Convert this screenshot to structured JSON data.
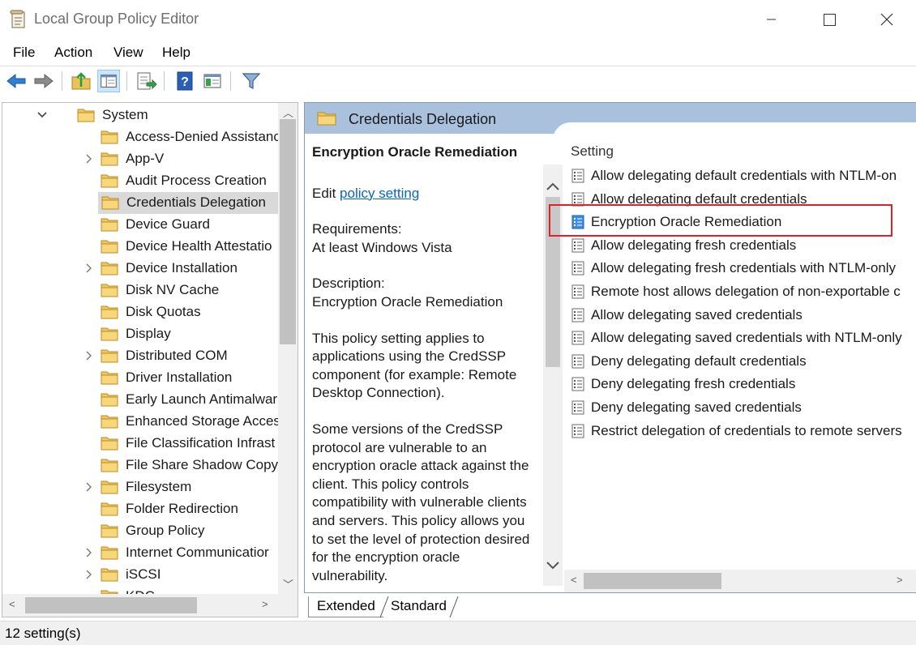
{
  "window": {
    "title": "Local Group Policy Editor"
  },
  "menu": [
    "File",
    "Action",
    "View",
    "Help"
  ],
  "toolbar": {
    "icons": [
      "back-arrow-icon",
      "forward-arrow-icon",
      "up-folder-icon",
      "show-hide-tree-icon",
      "export-list-icon",
      "help-icon",
      "extended-view-icon",
      "filter-icon"
    ]
  },
  "tree": {
    "items": [
      {
        "label": "System",
        "expander": "expanded",
        "selected": false,
        "indent": 0
      },
      {
        "label": "Access-Denied Assistanc",
        "expander": "none",
        "selected": false,
        "indent": 1
      },
      {
        "label": "App-V",
        "expander": "collapsed",
        "selected": false,
        "indent": 1
      },
      {
        "label": "Audit Process Creation",
        "expander": "none",
        "selected": false,
        "indent": 1
      },
      {
        "label": "Credentials Delegation",
        "expander": "none",
        "selected": true,
        "indent": 1
      },
      {
        "label": "Device Guard",
        "expander": "none",
        "selected": false,
        "indent": 1
      },
      {
        "label": "Device Health Attestatio",
        "expander": "none",
        "selected": false,
        "indent": 1
      },
      {
        "label": "Device Installation",
        "expander": "collapsed",
        "selected": false,
        "indent": 1
      },
      {
        "label": "Disk NV Cache",
        "expander": "none",
        "selected": false,
        "indent": 1
      },
      {
        "label": "Disk Quotas",
        "expander": "none",
        "selected": false,
        "indent": 1
      },
      {
        "label": "Display",
        "expander": "none",
        "selected": false,
        "indent": 1
      },
      {
        "label": "Distributed COM",
        "expander": "collapsed",
        "selected": false,
        "indent": 1
      },
      {
        "label": "Driver Installation",
        "expander": "none",
        "selected": false,
        "indent": 1
      },
      {
        "label": "Early Launch Antimalwar",
        "expander": "none",
        "selected": false,
        "indent": 1
      },
      {
        "label": "Enhanced Storage Acces",
        "expander": "none",
        "selected": false,
        "indent": 1
      },
      {
        "label": "File Classification Infrast",
        "expander": "none",
        "selected": false,
        "indent": 1
      },
      {
        "label": "File Share Shadow Copy",
        "expander": "none",
        "selected": false,
        "indent": 1
      },
      {
        "label": "Filesystem",
        "expander": "collapsed",
        "selected": false,
        "indent": 1
      },
      {
        "label": "Folder Redirection",
        "expander": "none",
        "selected": false,
        "indent": 1
      },
      {
        "label": "Group Policy",
        "expander": "none",
        "selected": false,
        "indent": 1
      },
      {
        "label": "Internet Communicatior",
        "expander": "collapsed",
        "selected": false,
        "indent": 1
      },
      {
        "label": "iSCSI",
        "expander": "collapsed",
        "selected": false,
        "indent": 1
      },
      {
        "label": "KDC",
        "expander": "none",
        "selected": false,
        "indent": 1
      }
    ]
  },
  "details": {
    "folder_title": "Credentials Delegation",
    "policy_name": "Encryption Oracle Remediation",
    "edit_prefix": "Edit",
    "edit_link": "policy setting",
    "requirements_label": "Requirements:",
    "requirements_value": "At least Windows Vista",
    "description_label": "Description:",
    "description_value": "Encryption Oracle Remediation",
    "paragraph1": "This policy setting applies to applications using the CredSSP component (for example: Remote Desktop Connection).",
    "paragraph2": "Some versions of the CredSSP protocol are vulnerable to an encryption oracle attack against the client.  This policy controls compatibility with vulnerable clients and servers.  This policy allows you to set the level of protection desired for the encryption oracle vulnerability."
  },
  "settings": {
    "column_header": "Setting",
    "items": [
      {
        "label": "Allow delegating default credentials with NTLM-on",
        "highlighted": false
      },
      {
        "label": "Allow delegating default credentials",
        "highlighted": false
      },
      {
        "label": "Encryption Oracle Remediation",
        "highlighted": true
      },
      {
        "label": "Allow delegating fresh credentials",
        "highlighted": false
      },
      {
        "label": "Allow delegating fresh credentials with NTLM-only",
        "highlighted": false
      },
      {
        "label": "Remote host allows delegation of non-exportable c",
        "highlighted": false
      },
      {
        "label": "Allow delegating saved credentials",
        "highlighted": false
      },
      {
        "label": "Allow delegating saved credentials with NTLM-only",
        "highlighted": false
      },
      {
        "label": "Deny delegating default credentials",
        "highlighted": false
      },
      {
        "label": "Deny delegating fresh credentials",
        "highlighted": false
      },
      {
        "label": "Deny delegating saved credentials",
        "highlighted": false
      },
      {
        "label": "Restrict delegation of credentials to remote servers",
        "highlighted": false
      }
    ]
  },
  "tabs": {
    "extended": "Extended",
    "standard": "Standard",
    "active": "Extended"
  },
  "status": {
    "text": "12 setting(s)"
  },
  "colors": {
    "header_band": "#a9c1dd",
    "highlight_box": "#e0202a",
    "link": "#0b64c0",
    "selected_row": "#d9d9d9"
  }
}
